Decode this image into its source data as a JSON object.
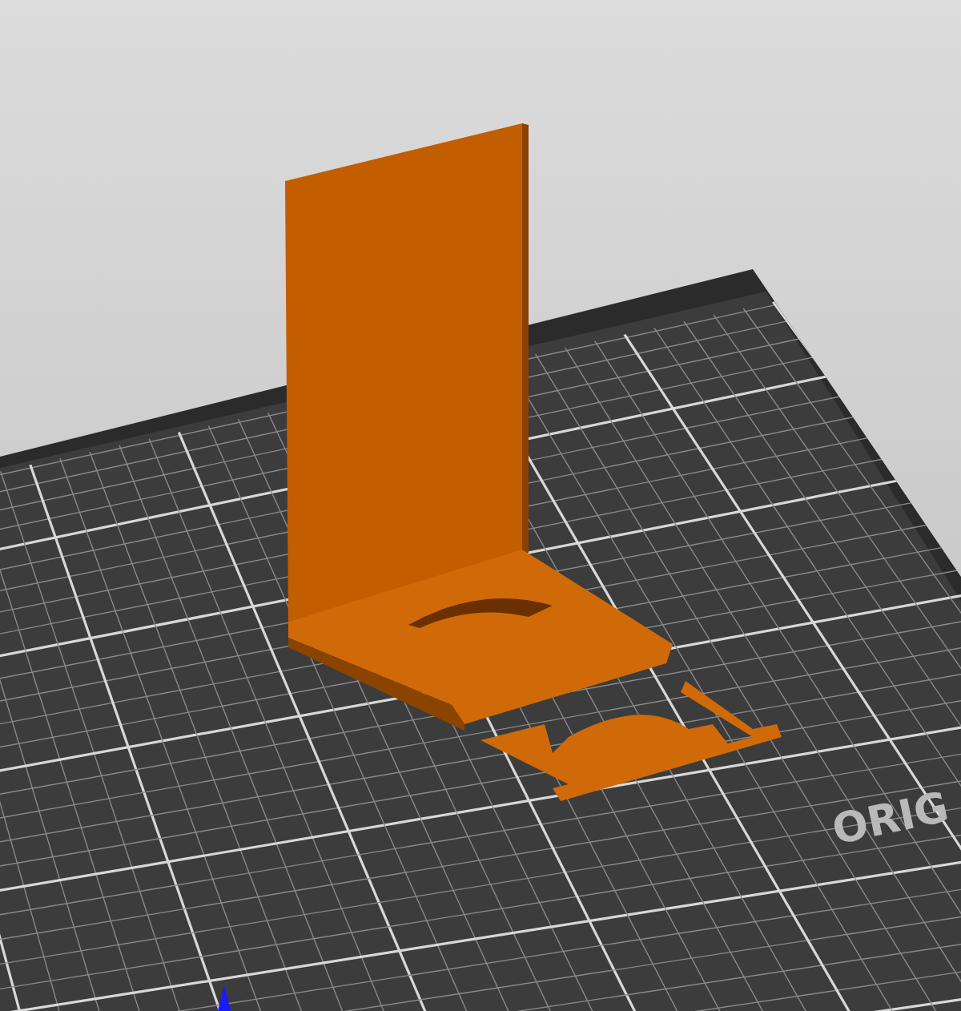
{
  "viewport": {
    "bed_label": "ORIG"
  }
}
